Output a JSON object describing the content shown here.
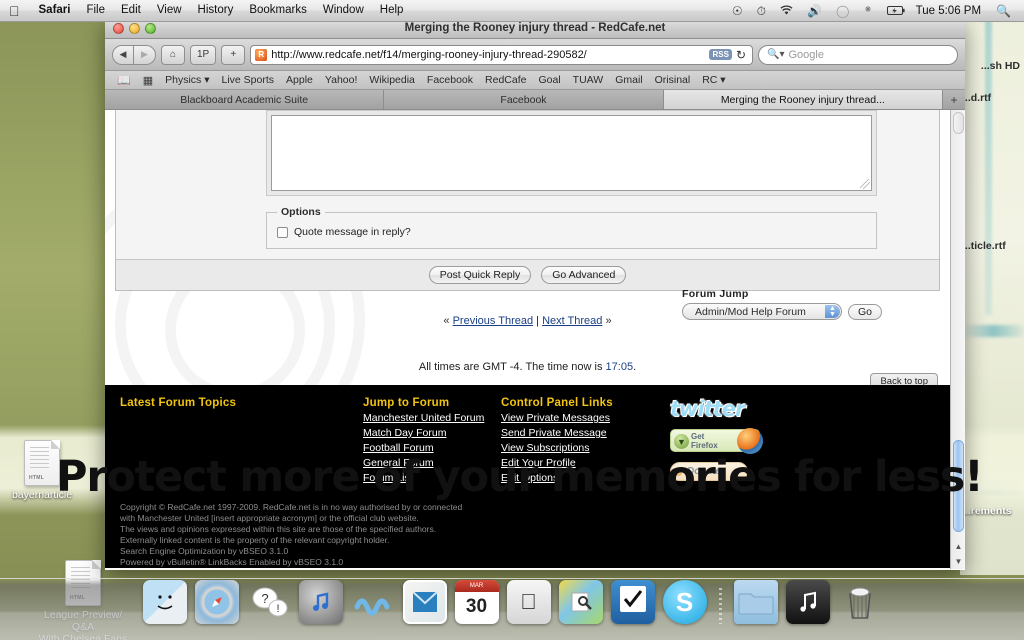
{
  "menubar": {
    "apple": "apple-logo",
    "items": [
      {
        "label": "Safari",
        "bold": true
      },
      {
        "label": "File",
        "bold": false
      },
      {
        "label": "Edit",
        "bold": false
      },
      {
        "label": "View",
        "bold": false
      },
      {
        "label": "History",
        "bold": false
      },
      {
        "label": "Bookmarks",
        "bold": false
      },
      {
        "label": "Window",
        "bold": false
      },
      {
        "label": "Help",
        "bold": false
      }
    ],
    "status_icons": [
      "quicksilver-icon",
      "timemachine-icon",
      "wifi-icon",
      "volume-icon",
      "chat-bubble-icon",
      "bluetooth-icon",
      "battery-icon"
    ],
    "clock": "Tue 5:06 PM",
    "spotlight": "search-icon"
  },
  "window": {
    "title": "Merging the Rooney injury thread - RedCafe.net",
    "traffic_lights": [
      "close",
      "minimize",
      "zoom"
    ]
  },
  "toolbar": {
    "back": "◀",
    "forward": "▶",
    "home": "⌂",
    "page_icon": "1P",
    "add": "+",
    "url": "http://www.redcafe.net/f14/merging-rooney-injury-thread-290582/",
    "rss_badge": "RSS",
    "reload": "↻",
    "search_placeholder": "Google",
    "search_value": ""
  },
  "bookmarks": {
    "icons": [
      "book-icon",
      "grid-icon"
    ],
    "items": [
      "Physics ▾",
      "Live Sports",
      "Apple",
      "Yahoo!",
      "Wikipedia",
      "Facebook",
      "RedCafe",
      "Goal",
      "TUAW",
      "Gmail",
      "Orisinal",
      "RC ▾"
    ]
  },
  "tabs": {
    "items": [
      {
        "label": "Blackboard Academic Suite",
        "active": false
      },
      {
        "label": "Facebook",
        "active": false
      },
      {
        "label": "Merging the Rooney injury thread...",
        "active": true
      }
    ],
    "new_tab": "+"
  },
  "quick_reply": {
    "textarea_value": "",
    "options_legend": "Options",
    "quote_checkbox_label": "Quote message in reply?",
    "quote_checked": false,
    "post_button": "Post Quick Reply",
    "advanced_button": "Go Advanced"
  },
  "thread_nav": {
    "left_chevron": "«",
    "previous": "Previous Thread",
    "separator": "|",
    "next": "Next Thread",
    "right_chevron": "»"
  },
  "forum_jump": {
    "label": "Forum Jump",
    "selected": "Admin/Mod Help Forum",
    "go_button": "Go"
  },
  "times": {
    "prefix": "All times are GMT -4. The time now is ",
    "time": "17:05",
    "suffix": "."
  },
  "back_to_top": "Back to top",
  "footer": {
    "col1": {
      "heading": "Latest Forum Topics",
      "links": []
    },
    "col2": {
      "heading": "Jump to Forum",
      "links": [
        "Manchester United Forum",
        "Match Day Forum",
        "Football Forum",
        "General Forum",
        "Forum List"
      ]
    },
    "col3": {
      "heading": "Control Panel Links",
      "links": [
        "View Private Messages",
        "Send Private Message",
        "View Subscriptions",
        "Edit Your Profile",
        "Edit Options"
      ]
    },
    "twitter_logo": "twitter",
    "get_firefox": {
      "line1": "Get",
      "line2": "Firefox"
    },
    "donate": "Donate",
    "copyright": [
      "Copyright © RedCafe.net 1997-2009. RedCafe.net is in no way authorised by or connected",
      "with Manchester United [insert appropriate acronym] or the official club website.",
      "The views and opinions expressed within this site are those of the specified authors.",
      "Externally linked content is the property of the relevant copyright holder.",
      "Search Engine Optimization by vBSEO 3.1.0",
      "Powered by vBulletin® LinkBacks Enabled by vBSEO 3.1.0"
    ]
  },
  "watermark": {
    "text": "Protect more of your memories for less!"
  },
  "desktop": {
    "icons": [
      {
        "label": "bayernarticle",
        "badge": "HTML"
      },
      {
        "label": "League Preview/ Q&A\nWith Chelsea Fans",
        "badge": "HTML"
      },
      {
        "label": "...sh HD",
        "badge": ""
      },
      {
        "label": "...d.rtf",
        "badge": ""
      },
      {
        "label": "...ticle.rtf",
        "badge": ""
      },
      {
        "label": "...rements",
        "badge": ""
      }
    ]
  },
  "dock": {
    "items": [
      {
        "name": "finder-icon",
        "glyph": "☺"
      },
      {
        "name": "safari-icon",
        "glyph": "☉"
      },
      {
        "name": "adium-icon",
        "glyph": "?!"
      },
      {
        "name": "itunes-icon",
        "glyph": "♫"
      },
      {
        "name": "transmit-icon",
        "glyph": "≈"
      },
      {
        "name": "mail-icon",
        "glyph": "✉"
      },
      {
        "name": "ical-icon",
        "glyph": "30"
      },
      {
        "name": "appstore-icon",
        "glyph": ""
      },
      {
        "name": "preview-icon",
        "glyph": "◆"
      },
      {
        "name": "things-icon",
        "glyph": "✔"
      },
      {
        "name": "skype-icon",
        "glyph": "S"
      },
      {
        "name": "documents-folder-icon",
        "glyph": "▭"
      },
      {
        "name": "music-stack-icon",
        "glyph": "♫"
      },
      {
        "name": "trash-icon",
        "glyph": "Ὕ1"
      }
    ]
  },
  "colors": {
    "footer_heading": "#f1c40f",
    "link_blue": "#1a3f86",
    "footer_bg": "#000000",
    "desktop_green": "#9aa463"
  }
}
